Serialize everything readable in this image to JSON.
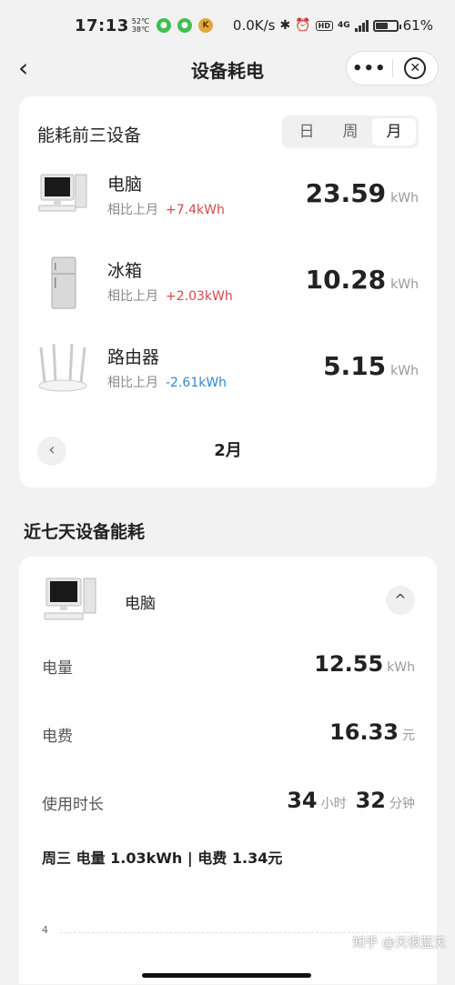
{
  "status": {
    "time": "17:13",
    "temp_high": "52℃",
    "temp_low": "38℃",
    "speed": "0.0K/s",
    "net": "4G",
    "battery": "61",
    "battery_suffix": "%",
    "battery_level": 0.61,
    "hd": "HD",
    "app_icon_k": "K"
  },
  "nav": {
    "back": "‹",
    "title": "设备耗电",
    "more": "•••",
    "close": "✕"
  },
  "top3": {
    "title": "能耗前三设备",
    "tabs": [
      "日",
      "周",
      "月"
    ],
    "active_tab": "月",
    "compare_label": "相比上月",
    "unit": "kWh",
    "devices": [
      {
        "name": "电脑",
        "delta": "+7.4kWh",
        "value": "23.59",
        "icon": "computer-icon"
      },
      {
        "name": "冰箱",
        "delta": "+2.03kWh",
        "value": "10.28",
        "icon": "fridge-icon"
      },
      {
        "name": "路由器",
        "delta": "-2.61kWh",
        "value": "5.15",
        "icon": "router-icon"
      }
    ],
    "period": "2月",
    "prev": "‹"
  },
  "week": {
    "title": "近七天设备能耗",
    "device": "电脑",
    "collapse": "^",
    "power_label": "电量",
    "power_value": "12.55",
    "power_unit": "kWh",
    "cost_label": "电费",
    "cost_value": "16.33",
    "cost_unit": "元",
    "time_label": "使用时长",
    "hours": "34",
    "hours_unit": "小时",
    "minutes": "32",
    "minutes_unit": "分钟",
    "summary": "周三 电量 1.03kWh | 电费 1.34元",
    "axis_tick": "4"
  },
  "watermark": "知乎 @天很蓝天"
}
